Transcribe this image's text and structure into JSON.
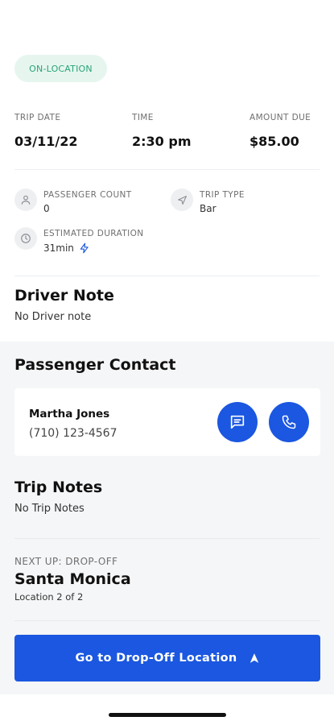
{
  "status": {
    "label": "ON-LOCATION",
    "color": "#2aa37a"
  },
  "summary": {
    "trip_date_label": "TRIP DATE",
    "trip_date": "03/11/22",
    "time_label": "TIME",
    "time": "2:30 pm",
    "amount_label": "AMOUNT DUE",
    "amount": "$85.00"
  },
  "details": {
    "passenger_count_label": "PASSENGER COUNT",
    "passenger_count": "0",
    "trip_type_label": "TRIP TYPE",
    "trip_type": "Bar",
    "duration_label": "ESTIMATED DURATION",
    "duration": "31min",
    "icons": [
      "user-icon",
      "navigation-arrow-icon",
      "clock-icon",
      "lightning-icon"
    ]
  },
  "driver_note": {
    "title": "Driver Note",
    "text": "No Driver note"
  },
  "passenger_contact": {
    "title": "Passenger Contact",
    "name": "Martha Jones",
    "phone": "(710) 123-4567",
    "icons": [
      "message-icon",
      "phone-icon"
    ]
  },
  "trip_notes": {
    "title": "Trip Notes",
    "text": "No Trip Notes"
  },
  "next_up": {
    "label": "NEXT UP: DROP-OFF",
    "place": "Santa Monica",
    "location_text": "Location 2 of 2"
  },
  "cta": {
    "label": "Go to Drop-Off Location",
    "color": "#1b57e0"
  }
}
